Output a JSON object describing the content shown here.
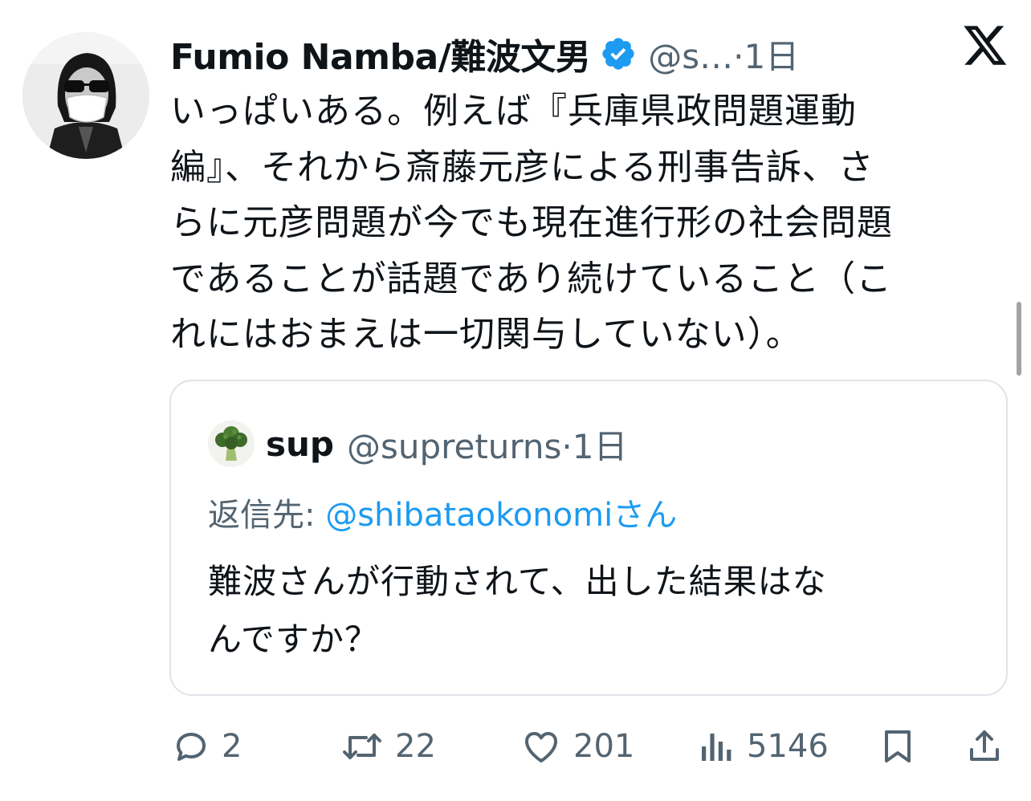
{
  "tweet": {
    "author": {
      "display_name": "Fumio Namba/難波文男",
      "verified": true,
      "meta": "@s…·1日",
      "avatar_icon": "profile-photo-masked-man"
    },
    "platform_icon": "x-logo-icon",
    "text_lines": [
      "いっぱいある。例えば『兵庫県政問題運動",
      "編』、それから斎藤元彦による刑事告訴、さ",
      "らに元彦問題が今でも現在進行形の社会問題",
      "であることが話題であり続けていること（こ",
      "れにはおまえは一切関与していない）。"
    ],
    "quote": {
      "display_name": "sup",
      "meta": "@supreturns·1日",
      "avatar_icon": "broccoli-icon",
      "reply_prefix": "返信先: ",
      "reply_mention": "@shibataokonomi",
      "reply_suffix": "さん",
      "text_lines": [
        "難波さんが行動されて、出した結果はな",
        "んですか？"
      ]
    },
    "actions": {
      "reply_count": "2",
      "retweet_count": "22",
      "like_count": "201",
      "view_count": "5146"
    }
  },
  "colors": {
    "text": "#0f1419",
    "secondary": "#536471",
    "accent": "#1d9bf0",
    "border": "#dfe3e8"
  }
}
